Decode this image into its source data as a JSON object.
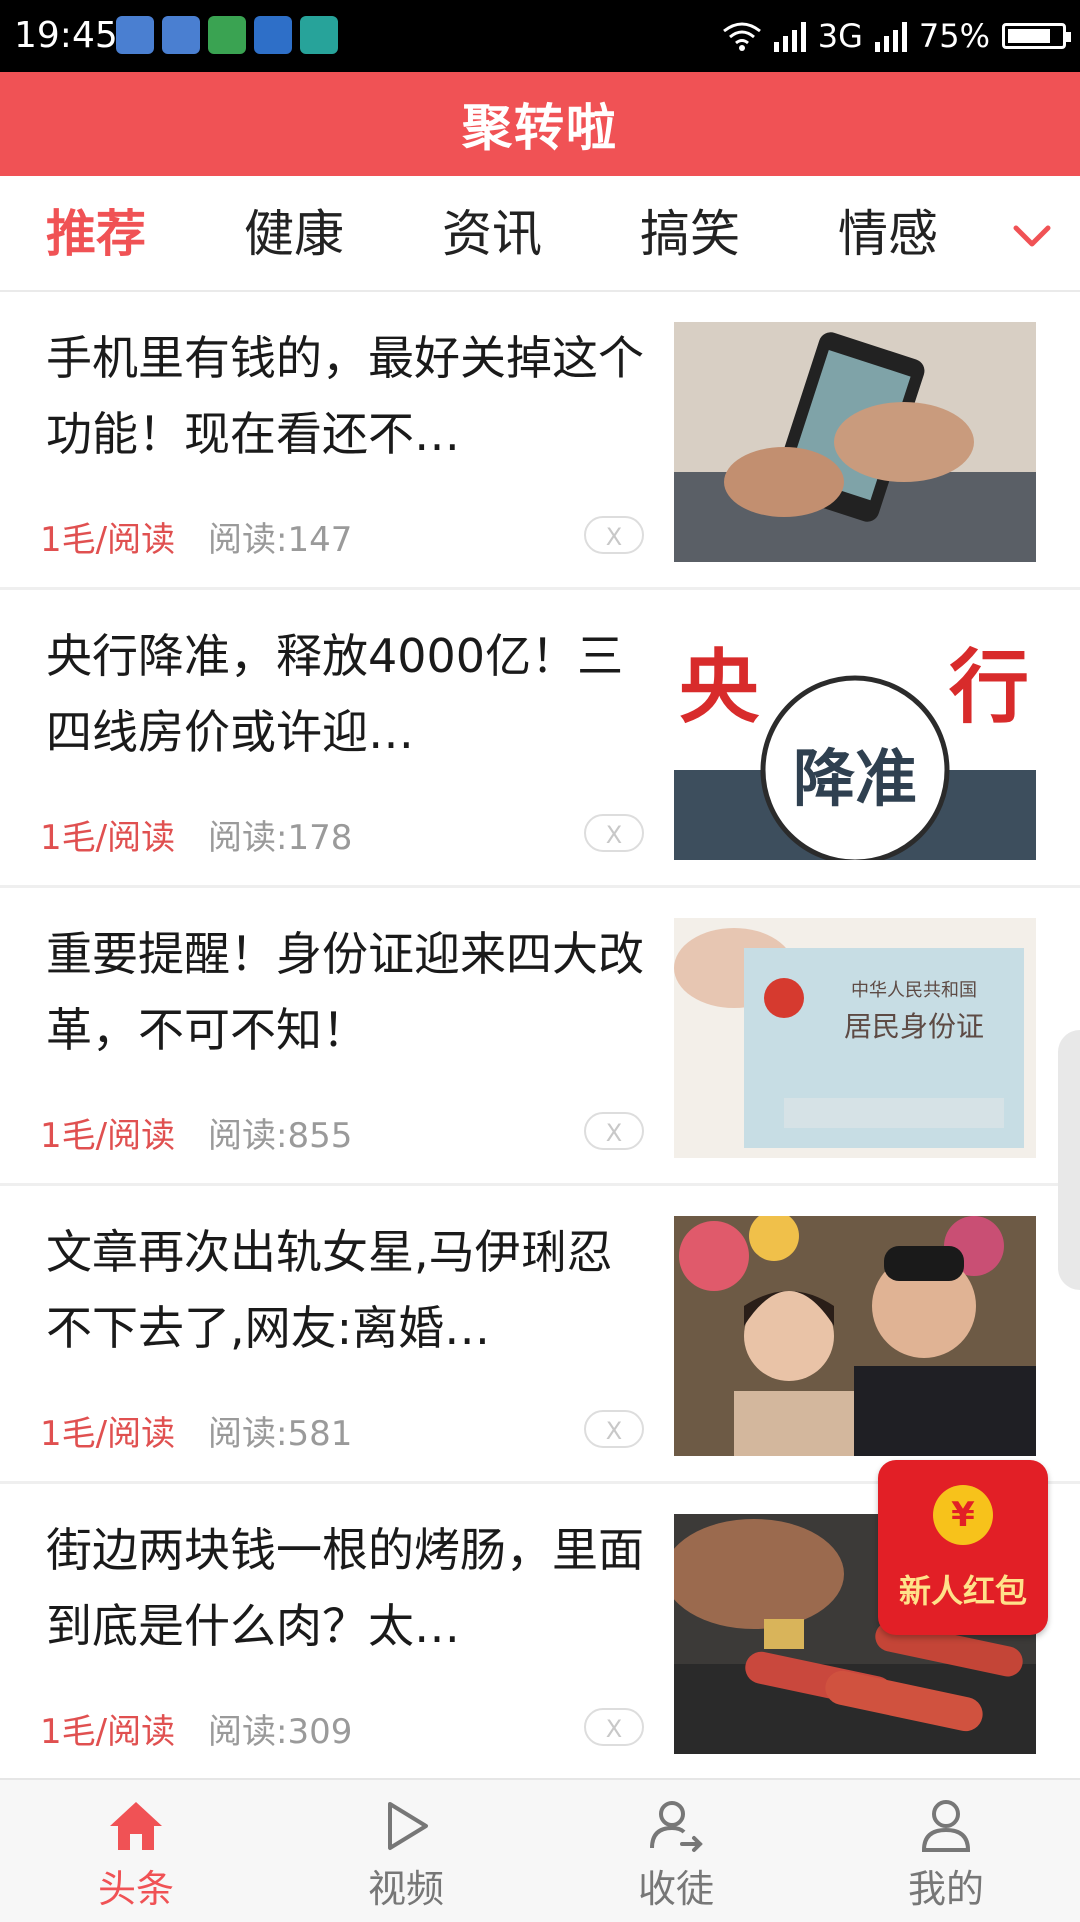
{
  "status_bar": {
    "time": "19:45",
    "network": "3G",
    "battery": "75%",
    "notification_icons": [
      "wechat-icon",
      "wechat-icon",
      "shield-icon",
      "message-icon",
      "scan-icon"
    ]
  },
  "app": {
    "title": "聚转啦",
    "accent_color": "#f05255"
  },
  "tabs": [
    {
      "label": "推荐",
      "active": true
    },
    {
      "label": "健康",
      "active": false
    },
    {
      "label": "资讯",
      "active": false
    },
    {
      "label": "搞笑",
      "active": false
    },
    {
      "label": "情感",
      "active": false
    }
  ],
  "articles": [
    {
      "title": "手机里有钱的，最好关掉这个功能！现在看还不…",
      "reward": "1毛/阅读",
      "reads": "阅读:147",
      "dismiss": "X"
    },
    {
      "title": "央行降准，释放4000亿！三四线房价或许迎…",
      "reward": "1毛/阅读",
      "reads": "阅读:178",
      "dismiss": "X"
    },
    {
      "title": "重要提醒！身份证迎来四大改革，不可不知！",
      "reward": "1毛/阅读",
      "reads": "阅读:855",
      "dismiss": "X"
    },
    {
      "title": "文章再次出轨女星,马伊琍忍不下去了,网友:离婚…",
      "reward": "1毛/阅读",
      "reads": "阅读:581",
      "dismiss": "X"
    },
    {
      "title": "街边两块钱一根的烤肠，里面到底是什么肉？太…",
      "reward": "1毛/阅读",
      "reads": "阅读:309",
      "dismiss": "X"
    }
  ],
  "thumb_text": {
    "pboc": [
      "央",
      "行",
      "降准"
    ],
    "idcard": [
      "中华人民共和国",
      "居民身份证"
    ]
  },
  "red_envelope": {
    "label": "新人红包",
    "coin": "¥"
  },
  "bottom_nav": [
    {
      "label": "头条",
      "icon": "home-icon",
      "active": true
    },
    {
      "label": "视频",
      "icon": "play-icon",
      "active": false
    },
    {
      "label": "收徒",
      "icon": "user-share-icon",
      "active": false
    },
    {
      "label": "我的",
      "icon": "user-icon",
      "active": false
    }
  ]
}
